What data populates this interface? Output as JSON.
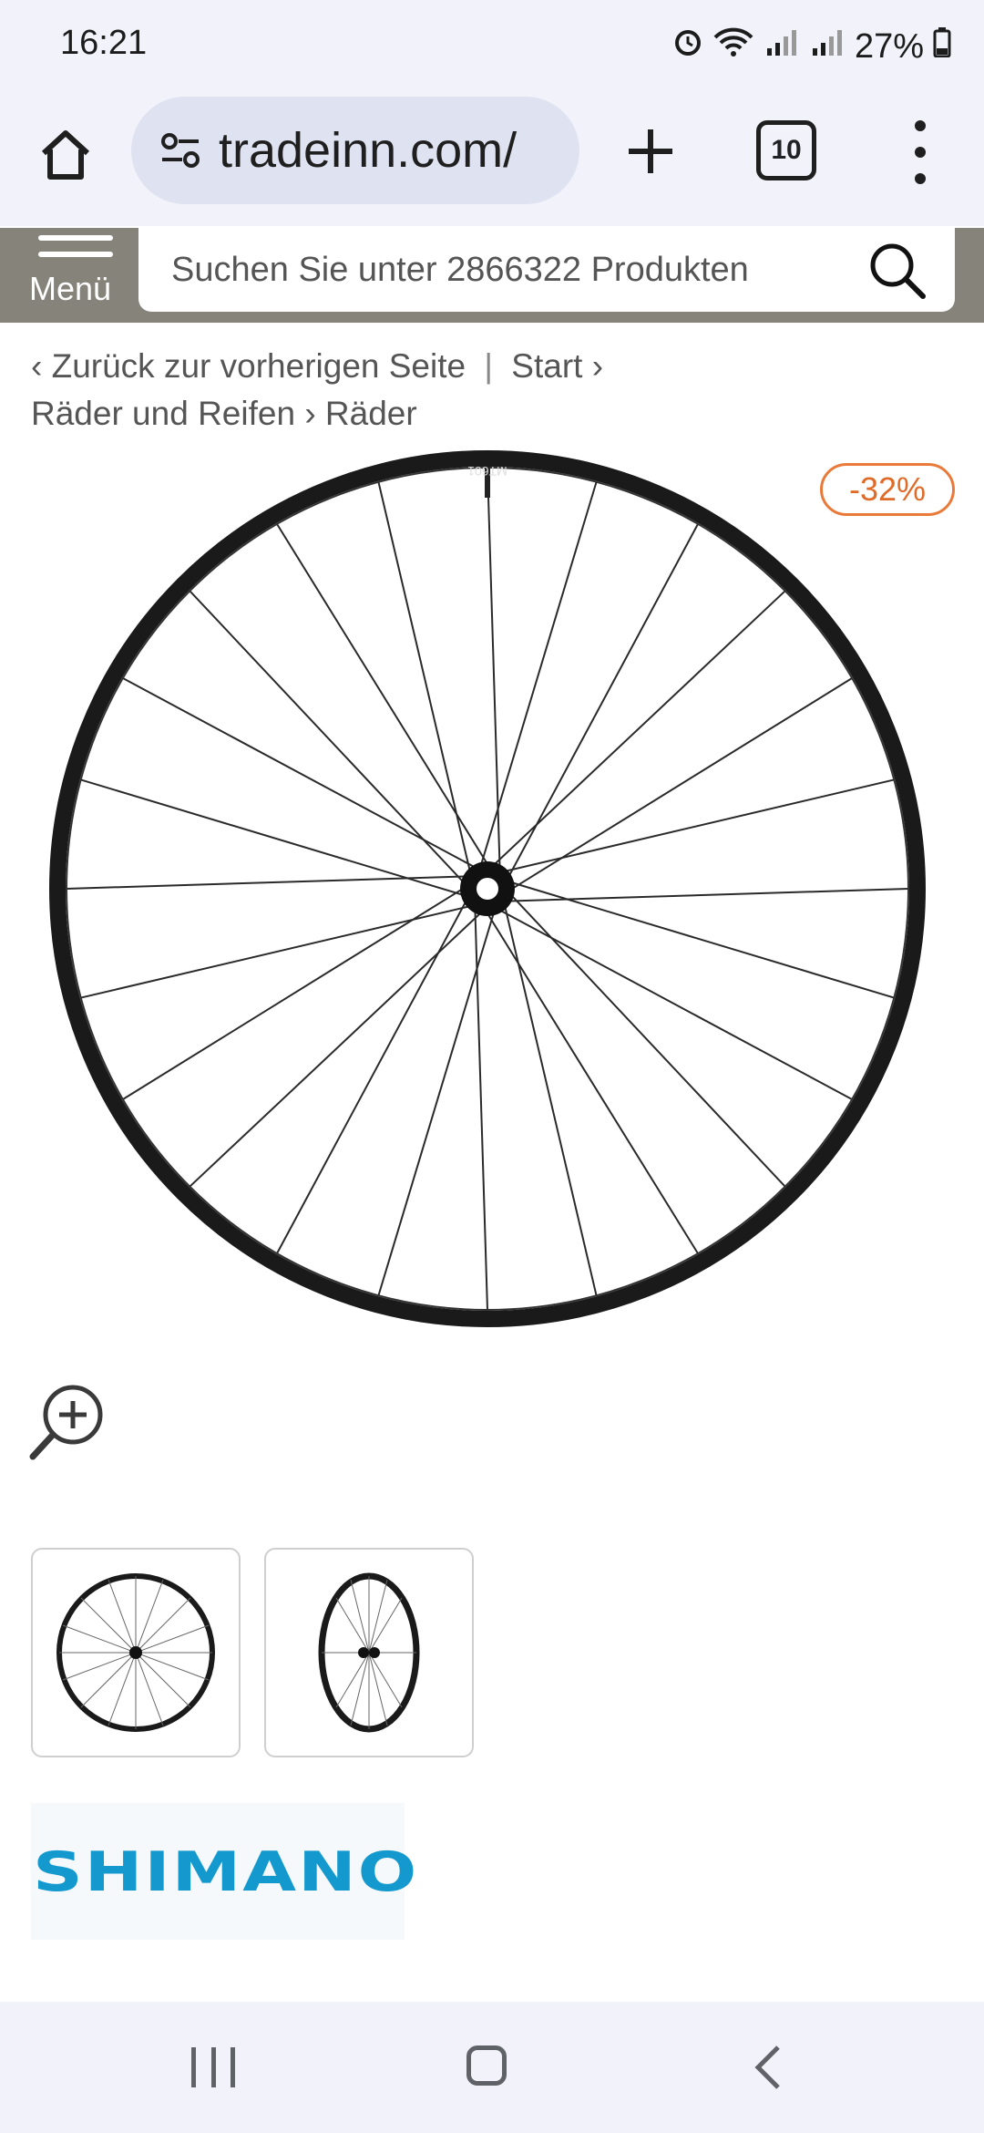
{
  "status_bar": {
    "time": "16:21",
    "battery": "27%"
  },
  "browser": {
    "url": "tradeinn.com/",
    "tab_count": "10"
  },
  "site_header": {
    "menu_label": "Menü",
    "search_placeholder": "Suchen Sie unter 2866322 Produkten"
  },
  "breadcrumb": {
    "back": "Zurück zur vorherigen Seite",
    "start": "Start",
    "category": "Räder und Reifen",
    "subcategory": "Räder"
  },
  "product": {
    "discount": "-32%",
    "rim_label": "MT601",
    "brand": "SHIMANO"
  },
  "icons": {
    "home": "home-icon",
    "site_settings": "site-settings-icon",
    "new_tab": "plus-icon",
    "tabs": "tabs-icon",
    "more": "more-vert-icon",
    "menu": "hamburger-icon",
    "search": "search-icon",
    "zoom": "zoom-in-icon"
  },
  "colors": {
    "header_bg": "#85837a",
    "discount_accent": "#e06b29",
    "brand_blue": "#1499cf"
  }
}
